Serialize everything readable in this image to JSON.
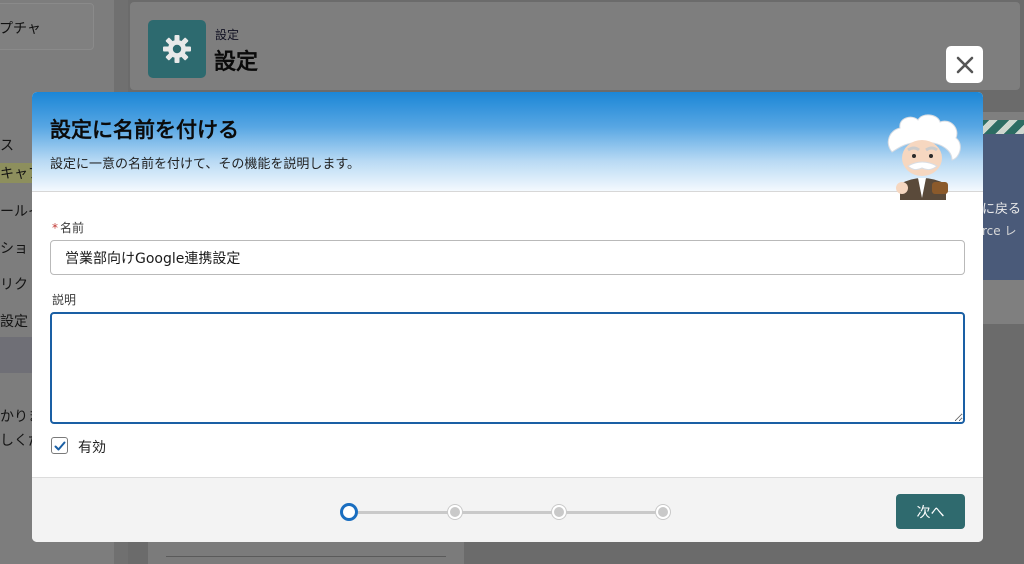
{
  "background": {
    "sidebar_top_item": "プチャ",
    "sidebar_items": [
      "ス",
      "キャプ",
      "ールイ",
      "ショ",
      "リク",
      "設定"
    ],
    "sidebar_bottom_lines": [
      "かりま",
      "しくだ"
    ],
    "page_eyebrow": "設定",
    "page_title": "設定",
    "right_card_line1": "に戻る",
    "right_card_line2": "rce レ"
  },
  "modal": {
    "title": "設定に名前を付ける",
    "subtitle": "設定に一意の名前を付けて、その機能を説明します。",
    "name_label": "名前",
    "name_required_mark": "*",
    "name_value": "営業部向けGoogle連携設定",
    "description_label": "説明",
    "description_value": "",
    "enabled_label": "有効",
    "enabled_checked": true,
    "next_button": "次へ",
    "steps_total": 4,
    "current_step": 1
  },
  "colors": {
    "accent": "#1a6ec0",
    "primary_button": "#2f6a6e",
    "required": "#c23934"
  },
  "icons": {
    "close": "close-icon",
    "gear": "gear-icon",
    "check": "checkmark-icon",
    "mascot": "einstein-mascot"
  }
}
